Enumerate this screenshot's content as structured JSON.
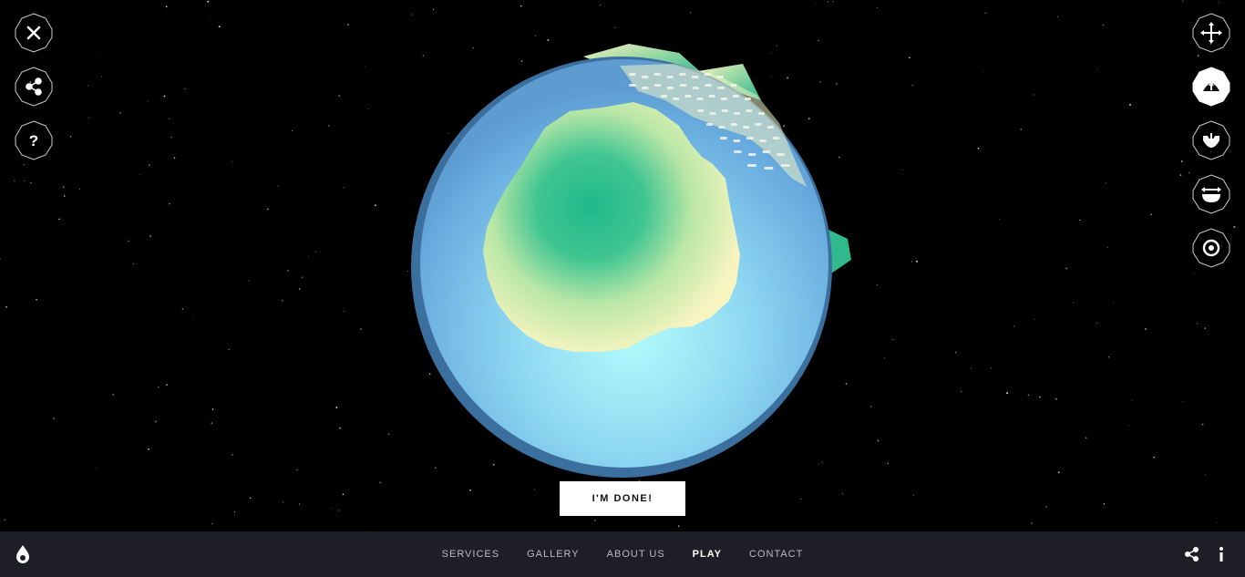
{
  "left_toolbar": {
    "items": [
      {
        "name": "close",
        "icon": "close-icon"
      },
      {
        "name": "share",
        "icon": "share-icon"
      },
      {
        "name": "help",
        "icon": "help-icon",
        "glyph": "?"
      }
    ]
  },
  "right_toolbar": {
    "items": [
      {
        "name": "move",
        "icon": "move-arrows-icon",
        "active": false
      },
      {
        "name": "raise",
        "icon": "raise-terrain-icon",
        "active": true
      },
      {
        "name": "lower",
        "icon": "lower-terrain-icon",
        "active": false
      },
      {
        "name": "flatten",
        "icon": "flatten-terrain-icon",
        "active": false
      },
      {
        "name": "target",
        "icon": "target-icon",
        "active": false
      }
    ]
  },
  "done_button": {
    "label": "I'M DONE!"
  },
  "footer": {
    "logo_icon": "droplet-logo-icon",
    "nav": [
      {
        "label": "SERVICES",
        "active": false
      },
      {
        "label": "GALLERY",
        "active": false
      },
      {
        "label": "ABOUT US",
        "active": false
      },
      {
        "label": "PLAY",
        "active": true
      },
      {
        "label": "CONTACT",
        "active": false
      }
    ],
    "share_icon": "share-icon",
    "info_icon": "info-icon"
  },
  "colors": {
    "background": "#000000",
    "footer_bg": "#1e1f26",
    "ocean_light": "#a9f0f5",
    "ocean_dark": "#3f79ad",
    "land_sand": "#f6f3bd",
    "land_green": "#1fb98a"
  }
}
